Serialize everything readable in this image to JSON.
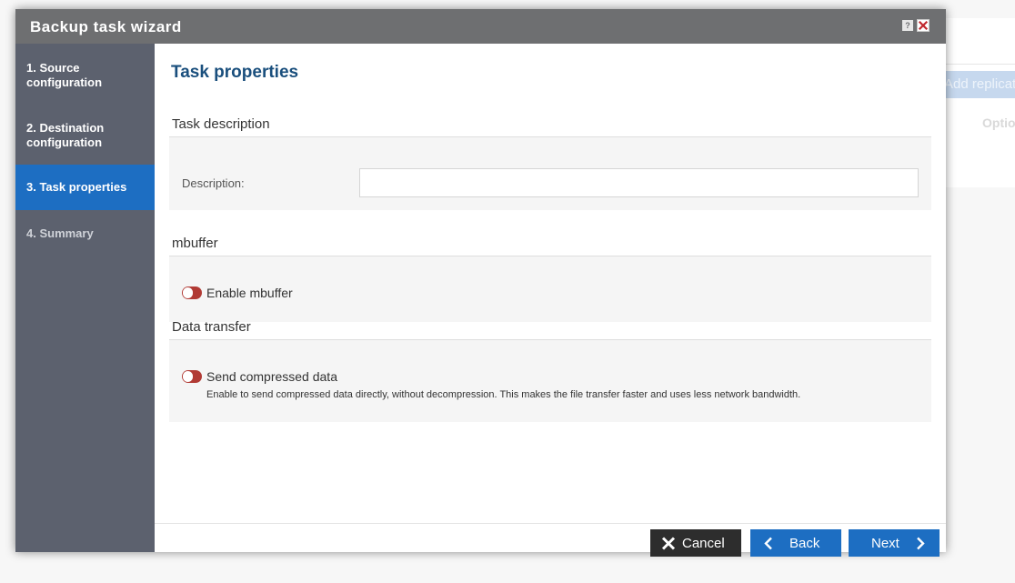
{
  "background": {
    "add_button": "Add replicat",
    "column_header": "Optio"
  },
  "dialog": {
    "title": "Backup task wizard",
    "help_label": "?"
  },
  "steps": [
    {
      "label": "1. Source configuration",
      "state": "done"
    },
    {
      "label": "2. Destination configuration",
      "state": "done"
    },
    {
      "label": "3. Task properties",
      "state": "active"
    },
    {
      "label": "4. Summary",
      "state": "disabled"
    }
  ],
  "page": {
    "title": "Task properties",
    "task_description": {
      "section_title": "Task description",
      "field_label": "Description:",
      "field_value": "",
      "field_placeholder": ""
    },
    "mbuffer": {
      "section_title": "mbuffer",
      "toggle_label": "Enable mbuffer",
      "toggle_on": false
    },
    "data_transfer": {
      "section_title": "Data transfer",
      "toggle_label": "Send compressed data",
      "toggle_on": false,
      "hint": "Enable to send compressed data directly, without decompression. This makes the file transfer faster and uses less network bandwidth."
    }
  },
  "footer": {
    "cancel_label": "Cancel",
    "back_label": "Back",
    "next_label": "Next"
  },
  "colors": {
    "accent": "#1d6ec2",
    "title_blue": "#1a4f7d",
    "sidebar": "#5c616e",
    "toggle_off": "#b13a34"
  }
}
